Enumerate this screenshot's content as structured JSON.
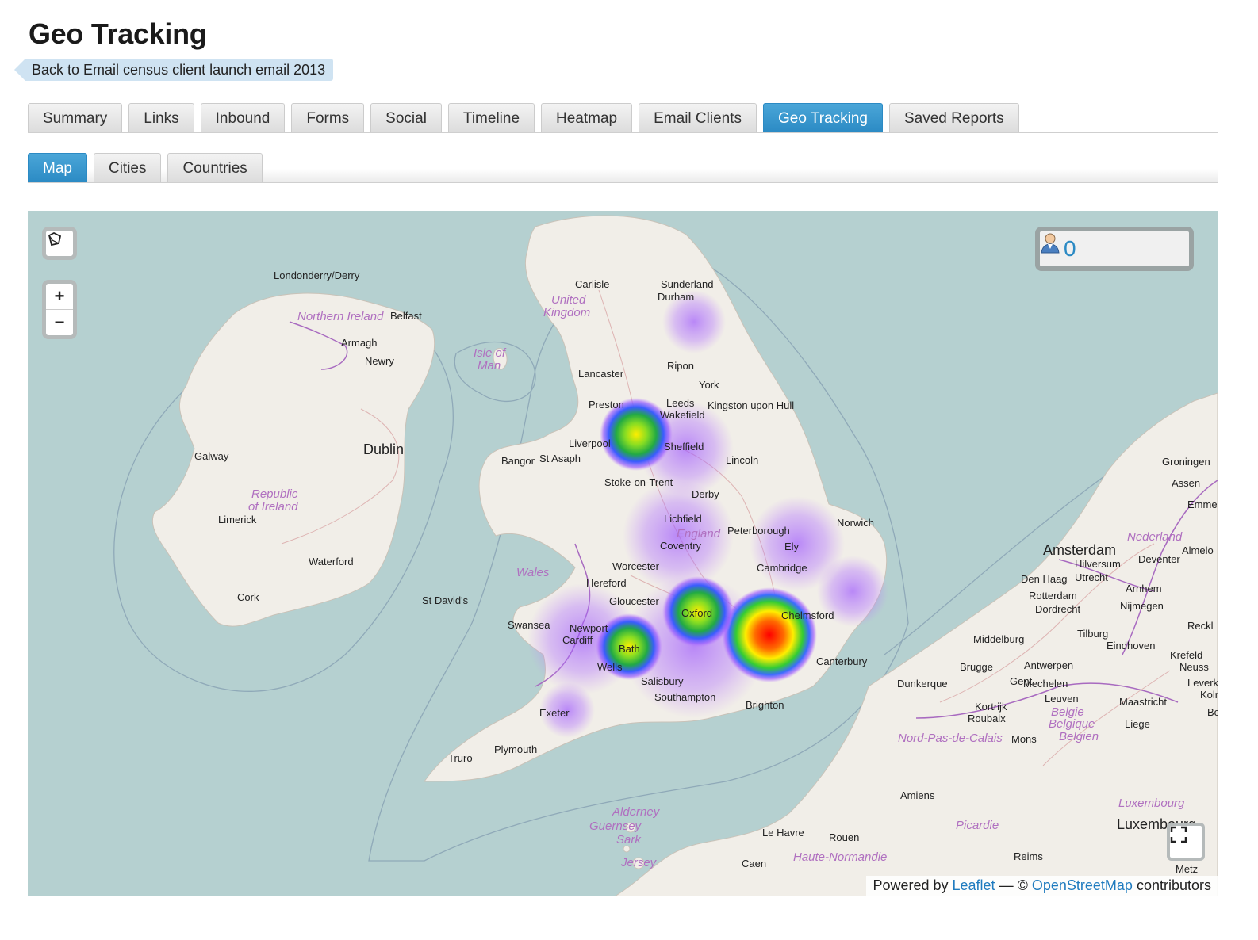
{
  "page": {
    "title": "Geo Tracking"
  },
  "back_link": {
    "label": "Back to Email census client launch email 2013"
  },
  "main_tabs": [
    {
      "label": "Summary",
      "active": false
    },
    {
      "label": "Links",
      "active": false
    },
    {
      "label": "Inbound",
      "active": false
    },
    {
      "label": "Forms",
      "active": false
    },
    {
      "label": "Social",
      "active": false
    },
    {
      "label": "Timeline",
      "active": false
    },
    {
      "label": "Heatmap",
      "active": false
    },
    {
      "label": "Email Clients",
      "active": false
    },
    {
      "label": "Geo Tracking",
      "active": true
    },
    {
      "label": "Saved Reports",
      "active": false
    }
  ],
  "sub_tabs": [
    {
      "label": "Map",
      "active": true
    },
    {
      "label": "Cities",
      "active": false
    },
    {
      "label": "Countries",
      "active": false
    }
  ],
  "map": {
    "controls": {
      "draw_icon": "lasso-select-icon",
      "zoom_in_icon": "plus-icon",
      "zoom_out_icon": "minus-icon",
      "fullscreen_icon": "fullscreen-icon"
    },
    "counter": {
      "icon": "person-icon",
      "value": "0"
    },
    "attribution": {
      "prefix": "Powered by",
      "leaflet": "Leaflet",
      "sep": "— ©",
      "osm": "OpenStreetMap",
      "suffix": "contributors"
    },
    "labels": [
      "Londonderry/Derry",
      "Northern Ireland",
      "Belfast",
      "Armagh",
      "Newry",
      "Dublin",
      "Galway",
      "Republic of Ireland",
      "Limerick",
      "Waterford",
      "Cork",
      "Carlisle",
      "United Kingdom",
      "Sunderland",
      "Durham",
      "Isle of Man",
      "Lancaster",
      "Ripon",
      "York",
      "Preston",
      "Leeds",
      "Wakefield",
      "Kingston upon Hull",
      "Liverpool",
      "Sheffield",
      "Bangor",
      "St Asaph",
      "Lincoln",
      "Stoke-on-Trent",
      "Derby",
      "Lichfield",
      "England",
      "Coventry",
      "Peterborough",
      "Ely",
      "Norwich",
      "Wales",
      "Worcester",
      "Cambridge",
      "Hereford",
      "St David's",
      "Gloucester",
      "Oxford",
      "Chelmsford",
      "Swansea",
      "Newport",
      "Cardiff",
      "Bath",
      "Wells",
      "Canterbury",
      "Salisbury",
      "Southampton",
      "Brighton",
      "Exeter",
      "Plymouth",
      "Truro",
      "Alderney",
      "Guernsey",
      "Sark",
      "Jersey",
      "Le Havre",
      "Rouen",
      "Caen",
      "Haute-Normandie",
      "Amiens",
      "Picardie",
      "Reims",
      "Luxembourg",
      "Dunkerque",
      "Nord-Pas-de-Calais",
      "Brugge",
      "Gent",
      "Kortrijk",
      "Roubaix",
      "Mons",
      "Belgie",
      "Belgique",
      "Belgien",
      "Antwerpen",
      "Mechelen",
      "Leuven",
      "Liege",
      "Maastricht",
      "Middelburg",
      "Tilburg",
      "Eindhoven",
      "Amsterdam",
      "Hilversum",
      "Utrecht",
      "Den Haag",
      "Rotterdam",
      "Dordrecht",
      "Arnhem",
      "Nijmegen",
      "Nederland",
      "Deventer",
      "Almelo",
      "Groningen",
      "Assen",
      "Emmen",
      "Krefeld",
      "Neuss",
      "Leverk",
      "Koln",
      "Bonn",
      "Reckl",
      "Metz"
    ],
    "heat_points": [
      {
        "label": "London",
        "intensity": 1.0
      },
      {
        "label": "Preston/Liverpool",
        "intensity": 0.55
      },
      {
        "label": "Oxford",
        "intensity": 0.55
      },
      {
        "label": "Bath",
        "intensity": 0.45
      },
      {
        "label": "Southampton",
        "intensity": 0.2
      },
      {
        "label": "Coventry",
        "intensity": 0.2
      },
      {
        "label": "Cambridge",
        "intensity": 0.2
      },
      {
        "label": "Cardiff",
        "intensity": 0.2
      },
      {
        "label": "Durham",
        "intensity": 0.12
      },
      {
        "label": "Exeter",
        "intensity": 0.1
      }
    ]
  }
}
